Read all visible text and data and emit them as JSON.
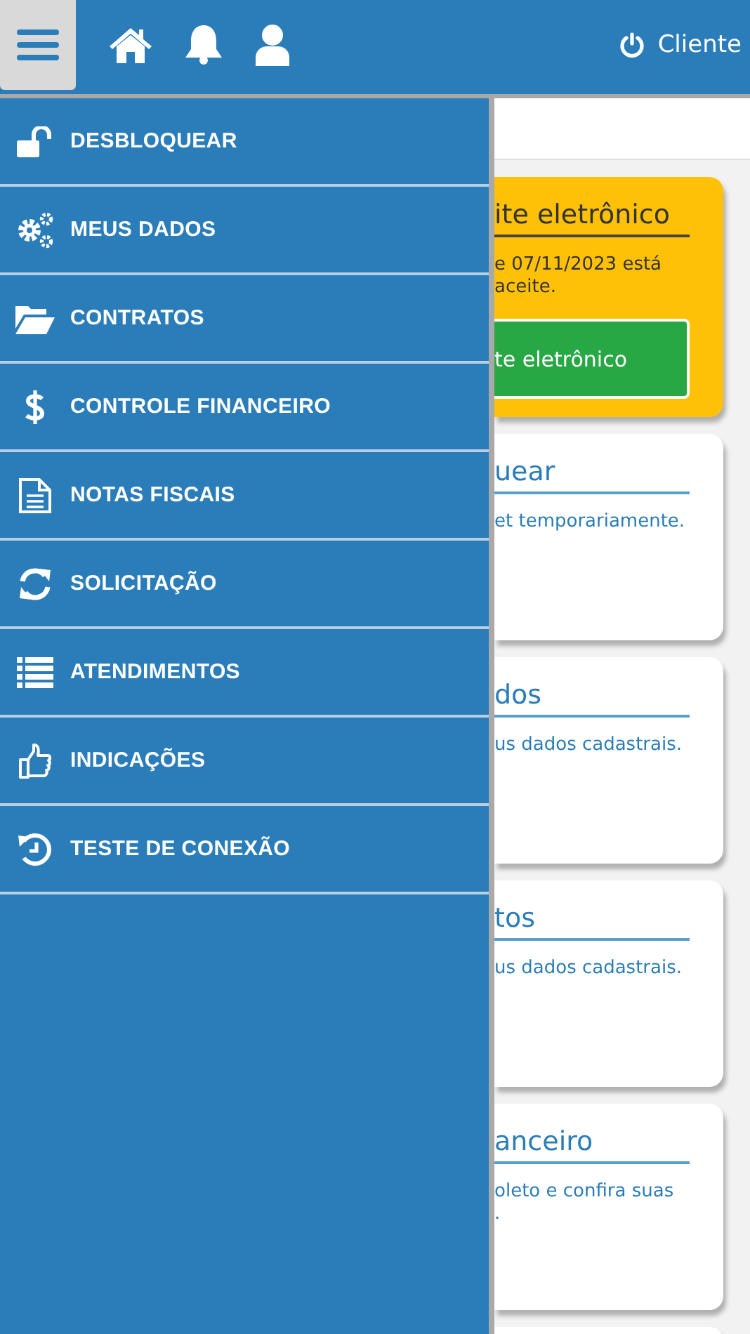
{
  "header": {
    "menu_open": true,
    "user_label": "Cliente"
  },
  "menu": [
    {
      "label": "DESBLOQUEAR"
    },
    {
      "label": "MEUS DADOS"
    },
    {
      "label": "CONTRATOS"
    },
    {
      "label": "CONTROLE FINANCEIRO"
    },
    {
      "label": "NOTAS FISCAIS"
    },
    {
      "label": "SOLICITAÇÃO"
    },
    {
      "label": "ATENDIMENTOS"
    },
    {
      "label": "INDICAÇÕES"
    },
    {
      "label": "TESTE DE CONEXÃO"
    }
  ],
  "cards": [
    {
      "kind": "alert",
      "title": "ite eletrônico",
      "lines": [
        "e 07/11/2023 está",
        "aceite."
      ],
      "button": "te eletrônico"
    },
    {
      "kind": "info",
      "title": "uear",
      "lines": [
        "et temporariamente."
      ]
    },
    {
      "kind": "info",
      "title": "dos",
      "lines": [
        "us dados cadastrais."
      ]
    },
    {
      "kind": "info",
      "title": "tos",
      "lines": [
        "us dados cadastrais."
      ]
    },
    {
      "kind": "info",
      "title": "anceiro",
      "lines": [
        "oleto e confira suas",
        "."
      ]
    },
    {
      "kind": "info"
    }
  ]
}
